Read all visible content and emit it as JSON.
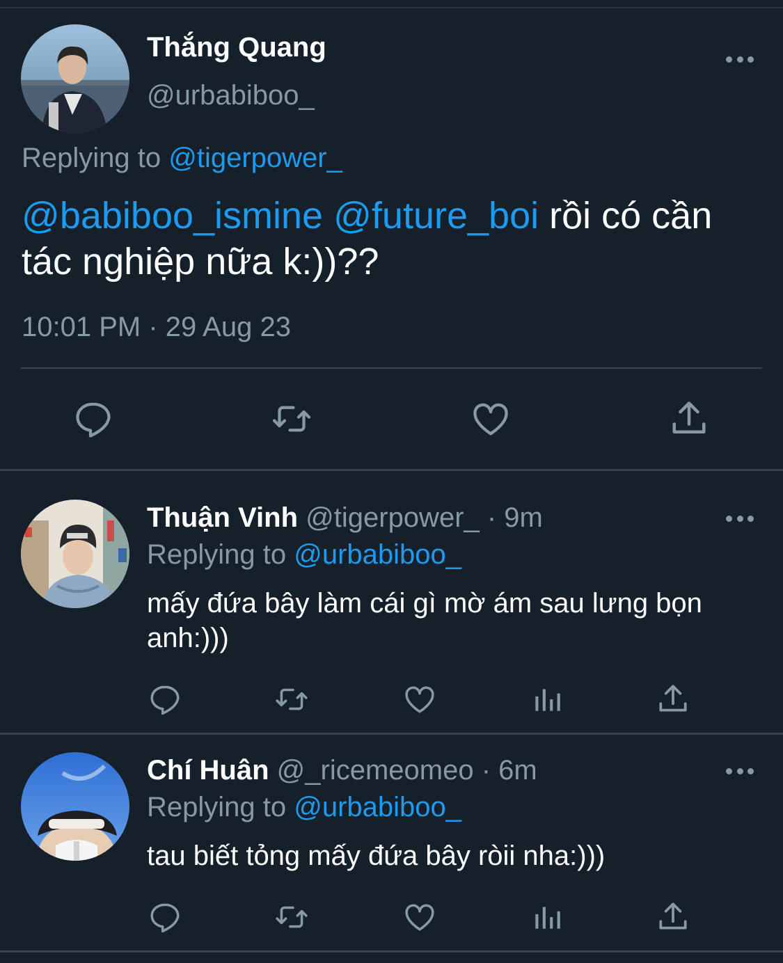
{
  "main_tweet": {
    "author_name": "Thắng Quang",
    "author_handle": "@urbabiboo_",
    "replying_prefix": "Replying to ",
    "replying_to": "@tigerpower_",
    "mention_1": "@babiboo_ismine",
    "mention_2": "@future_boi",
    "text_line_rest": " rồi có cần",
    "text_line_2": "tác nghiệp nữa k:))??",
    "timestamp": "10:01 PM · 29 Aug 23",
    "actions": [
      "reply-icon",
      "retweet-icon",
      "like-icon",
      "share-icon"
    ]
  },
  "replies": [
    {
      "author_name": "Thuận Vinh",
      "meta": " @tigerpower_ · 9m",
      "replying_prefix": "Replying to ",
      "replying_to": "@urbabiboo_",
      "text": "mấy đứa bây làm cái gì mờ ám sau lưng bọn anh:)))",
      "actions": [
        "reply-icon",
        "retweet-icon",
        "like-icon",
        "analytics-icon",
        "share-icon"
      ]
    },
    {
      "author_name": "Chí Huân",
      "meta": " @_ricemeomeo · 6m",
      "replying_prefix": "Replying to ",
      "replying_to": "@urbabiboo_",
      "text": "tau biết tỏng mấy đứa bây ròii nha:)))",
      "actions": [
        "reply-icon",
        "retweet-icon",
        "like-icon",
        "analytics-icon",
        "share-icon"
      ]
    }
  ],
  "colors": {
    "background": "#15202b",
    "secondary_text": "#8899a6",
    "link": "#1d9bf0",
    "divider": "#38444d"
  }
}
